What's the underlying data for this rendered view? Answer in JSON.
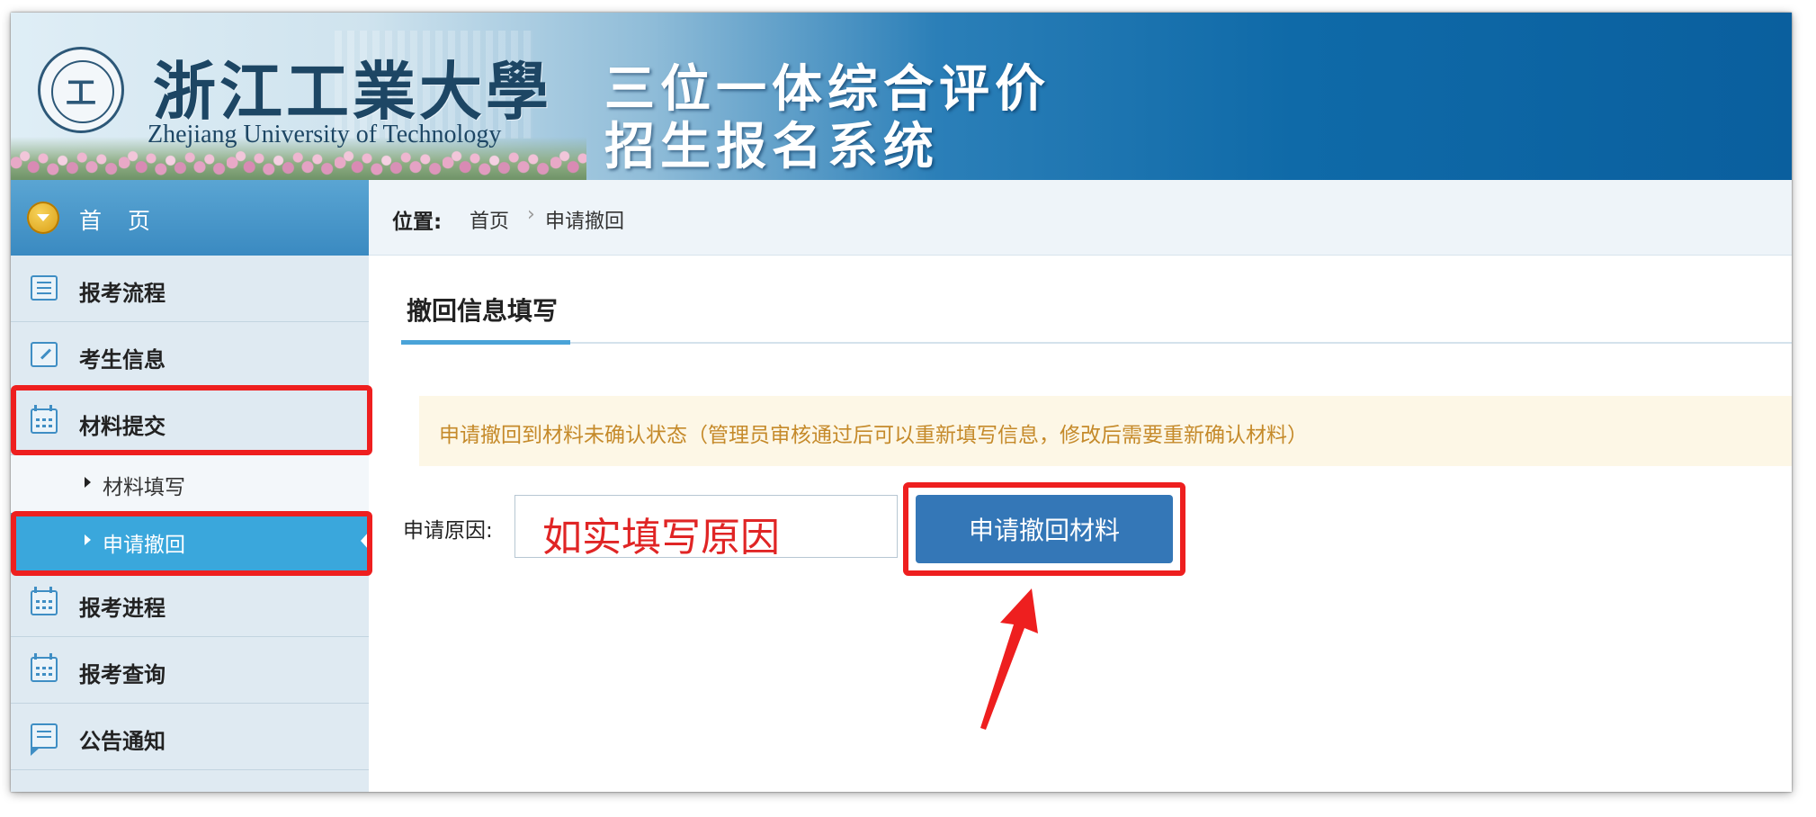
{
  "header": {
    "university_cn": "浙江工業大學",
    "university_en": "Zhejiang University of Technology",
    "system_line1": "三位一体综合评价",
    "system_line2": "招生报名系统",
    "seal_glyph": "工"
  },
  "sidebar": {
    "home_label": "首　页",
    "items": [
      {
        "label": "报考流程",
        "icon": "list-icon"
      },
      {
        "label": "考生信息",
        "icon": "edit-icon"
      },
      {
        "label": "材料提交",
        "icon": "calendar-icon"
      },
      {
        "label": "报考进程",
        "icon": "calendar-icon"
      },
      {
        "label": "报考查询",
        "icon": "calendar-icon"
      },
      {
        "label": "公告通知",
        "icon": "chat-icon"
      }
    ],
    "sub_items": [
      {
        "label": "材料填写",
        "active": false
      },
      {
        "label": "申请撤回",
        "active": true
      }
    ]
  },
  "breadcrumb": {
    "label": "位置:",
    "items": [
      "首页",
      "申请撤回"
    ],
    "separator": "›"
  },
  "section": {
    "title": "撤回信息填写"
  },
  "notice": "申请撤回到材料未确认状态（管理员审核通过后可以重新填写信息，修改后需要重新确认材料）",
  "form": {
    "reason_label": "申请原因:",
    "reason_annotation": "如实填写原因",
    "submit_label": "申请撤回材料"
  },
  "colors": {
    "highlight": "#ee1f1f",
    "button": "#3477b7",
    "active_menu": "#3aa7dc",
    "notice_text": "#c58a2a",
    "annotation_text": "#e02525"
  }
}
